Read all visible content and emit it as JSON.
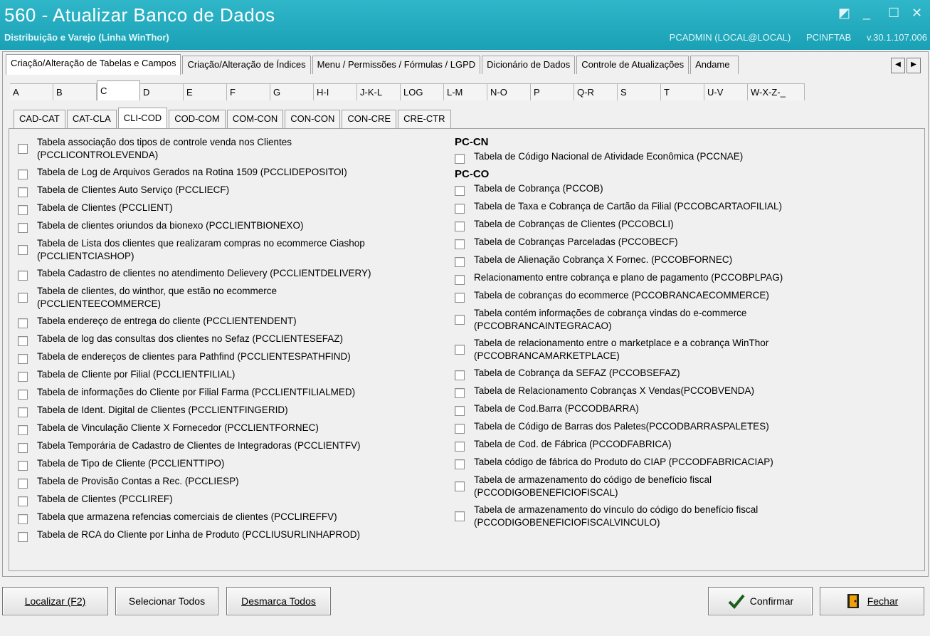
{
  "window": {
    "title": "560 - Atualizar Banco de Dados",
    "subtitle": "Distribuição e Varejo (Linha WinThor)",
    "user": "PCADMIN (LOCAL@LOCAL)",
    "schema": "PCINFTAB",
    "version": "v.30.1.107.006"
  },
  "main_tabs": [
    "Criação/Alteração de Tabelas e Campos",
    "Criação/Alteração de Índices",
    "Menu / Permissões / Fórmulas / LGPD",
    "Dicionário de Dados",
    "Controle de Atualizações",
    "Andame"
  ],
  "letter_tabs": [
    "A",
    "B",
    "C",
    "D",
    "E",
    "F",
    "G",
    "H-I",
    "J-K-L",
    "LOG",
    "L-M",
    "N-O",
    "P",
    "Q-R",
    "S",
    "T",
    "U-V",
    "W-X-Z-_"
  ],
  "sub_tabs": [
    "CAD-CAT",
    "CAT-CLA",
    "CLI-COD",
    "COD-COM",
    "COM-CON",
    "CON-CON",
    "CON-CRE",
    "CRE-CTR"
  ],
  "left_items": [
    "Tabela associação dos tipos de controle venda nos Clientes|(PCCLICONTROLEVENDA)",
    "Tabela de Log de Arquivos Gerados na Rotina 1509 (PCCLIDEPOSITOI)",
    "Tabela  de Clientes Auto Serviço (PCCLIECF)",
    "Tabela de Clientes (PCCLIENT)",
    "Tabela de clientes oriundos da bionexo (PCCLIENTBIONEXO)",
    "Tabela de Lista dos clientes que realizaram compras no ecommerce Ciashop|(PCCLIENTCIASHOP)",
    "Tabela Cadastro de clientes no atendimento Delievery (PCCLIENTDELIVERY)",
    "Tabela de clientes, do winthor, que estão no ecommerce|(PCCLIENTEECOMMERCE)",
    "Tabela endereço de entrega do cliente (PCCLIENTENDENT)",
    "Tabela de log das consultas dos clientes no Sefaz (PCCLIENTESEFAZ)",
    "Tabela de endereços de clientes para Pathfind (PCCLIENTESPATHFIND)",
    "Tabela de Cliente por Filial (PCCLIENTFILIAL)",
    "Tabela de informações do Cliente por Filial Farma (PCCLIENTFILIALMED)",
    "Tabela de Ident. Digital de Clientes (PCCLIENTFINGERID)",
    "Tabela de Vinculação Cliente X Fornecedor (PCCLIENTFORNEC)",
    "Tabela Temporária de Cadastro de Clientes de Integradoras (PCCLIENTFV)",
    "Tabela de Tipo de Cliente (PCCLIENTTIPO)",
    "Tabela de Provisão Contas a Rec. (PCCLIESP)",
    "Tabela de Clientes (PCCLIREF)",
    "Tabela que armazena refencias comerciais de clientes (PCCLIREFFV)",
    "Tabela de RCA do Cliente por Linha de Produto (PCCLIUSURLINHAPROD)"
  ],
  "right_groups": [
    {
      "header": "PC-CN",
      "items": [
        "Tabela de Código Nacional de Atividade Econômica (PCCNAE)"
      ]
    },
    {
      "header": "PC-CO",
      "items": [
        "Tabela de Cobrança (PCCOB)",
        "Tabela de Taxa e Cobrança de Cartão da Filial (PCCOBCARTAOFILIAL)",
        "Tabela de Cobranças de Clientes (PCCOBCLI)",
        "Tabela de Cobranças Parceladas (PCCOBECF)",
        "Tabela de Alienação Cobrança X Fornec. (PCCOBFORNEC)",
        "Relacionamento entre cobrança e plano de pagamento (PCCOBPLPAG)",
        "Tabela de cobranças do ecommerce (PCCOBRANCAECOMMERCE)",
        "Tabela contém informações de cobrança vindas do e-commerce|(PCCOBRANCAINTEGRACAO)",
        "Tabela de relacionamento entre o marketplace e a cobrança WinThor|(PCCOBRANCAMARKETPLACE)",
        "Tabela de Cobrança da SEFAZ (PCCOBSEFAZ)",
        "Tabela de Relacionamento Cobranças X Vendas(PCCOBVENDA)",
        "Tabela de Cod.Barra (PCCODBARRA)",
        "Tabela de Código de Barras dos Paletes(PCCODBARRASPALETES)",
        "Tabela de Cod. de Fábrica (PCCODFABRICA)",
        "Tabela código de fábrica do Produto do CIAP (PCCODFABRICACIAP)",
        "Tabela de armazenamento do código de benefício fiscal|(PCCODIGOBENEFICIOFISCAL)",
        "Tabela de armazenamento do vínculo do código do benefício fiscal|(PCCODIGOBENEFICIOFISCALVINCULO)"
      ]
    }
  ],
  "buttons": {
    "localizar": "Localizar (F2)",
    "selecionar": "Selecionar Todos",
    "desmarca": "Desmarca Todos",
    "confirmar": "Confirmar",
    "fechar": "Fechar"
  },
  "icons": {
    "confirm": "checkmark-icon",
    "close": "door-exit-icon"
  }
}
